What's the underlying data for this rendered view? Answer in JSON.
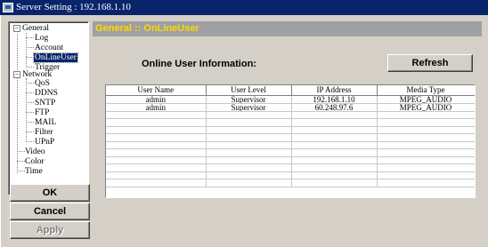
{
  "window": {
    "title": "Server Setting : 192.168.1.10"
  },
  "tree": {
    "general": "General",
    "log": "Log",
    "account": "Account",
    "online_user": "OnLineUser",
    "trigger": "Trigger",
    "network": "Network",
    "qos": "QoS",
    "ddns": "DDNS",
    "sntp": "SNTP",
    "ftp": "FTP",
    "mail": "MAIL",
    "filter": "Filter",
    "upnp": "UPnP",
    "video": "Video",
    "color": "Color",
    "time": "Time",
    "collapse_symbol": "−"
  },
  "content": {
    "header": "General :: OnLineUser",
    "section_label": "Online User Information:",
    "refresh_label": "Refresh"
  },
  "table": {
    "columns": [
      "User Name",
      "User Level",
      "IP Address",
      "Media Type"
    ],
    "rows": [
      [
        "admin",
        "Supervisor",
        "192.168.1.10",
        "MPEG_AUDIO"
      ],
      [
        "admin",
        "Supervisor",
        "60.248.97.6",
        "MPEG_AUDIO"
      ]
    ],
    "empty_rows": 10
  },
  "buttons": {
    "ok": "OK",
    "cancel": "Cancel",
    "apply": "Apply"
  },
  "colors": {
    "title_bar": "#08246b",
    "header_bg": "#9fa0a3",
    "header_text": "#ffd800",
    "selected_node": "#08246b"
  }
}
